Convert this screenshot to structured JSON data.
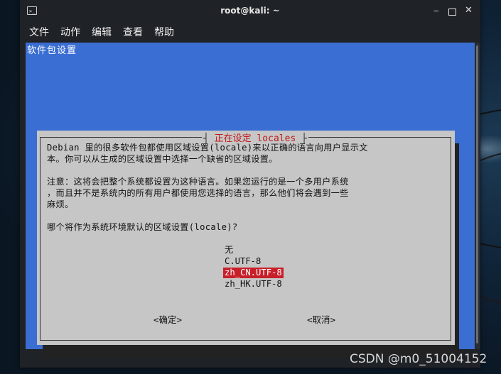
{
  "window": {
    "title": "root@kali: ~",
    "icon": "terminal-icon",
    "min": "‒",
    "close": "✕"
  },
  "menu": [
    "文件",
    "动作",
    "编辑",
    "查看",
    "帮助"
  ],
  "terminal": {
    "package_config_title": "软件包设置"
  },
  "dialog": {
    "title": "正在设定 locales",
    "lines": [
      "Debian 里的很多软件包都使用区域设置(locale)来以正确的语言向用户显示文",
      "本。你可以从生成的区域设置中选择一个缺省的区域设置。",
      "",
      "注意：这将会把整个系统都设置为这种语言。如果您运行的是一个多用户系统",
      "，而且并不是系统内的所有用户都使用您选择的语言，那么他们将会遇到一些",
      "麻烦。",
      "",
      "哪个将作为系统环境默认的区域设置(locale)?"
    ],
    "options": [
      "无",
      "C.UTF-8",
      "zh_CN.UTF-8",
      "zh_HK.UTF-8"
    ],
    "selected_option": "zh_CN.UTF-8",
    "ok_label": "<确定>",
    "cancel_label": "<取消>"
  },
  "watermark": "CSDN @m0_51004152",
  "colors": {
    "terminal_bg": "#3a6ed2",
    "dialog_bg": "#c6c6c6",
    "selection": "#c8202a",
    "title_text": "#c01818"
  }
}
